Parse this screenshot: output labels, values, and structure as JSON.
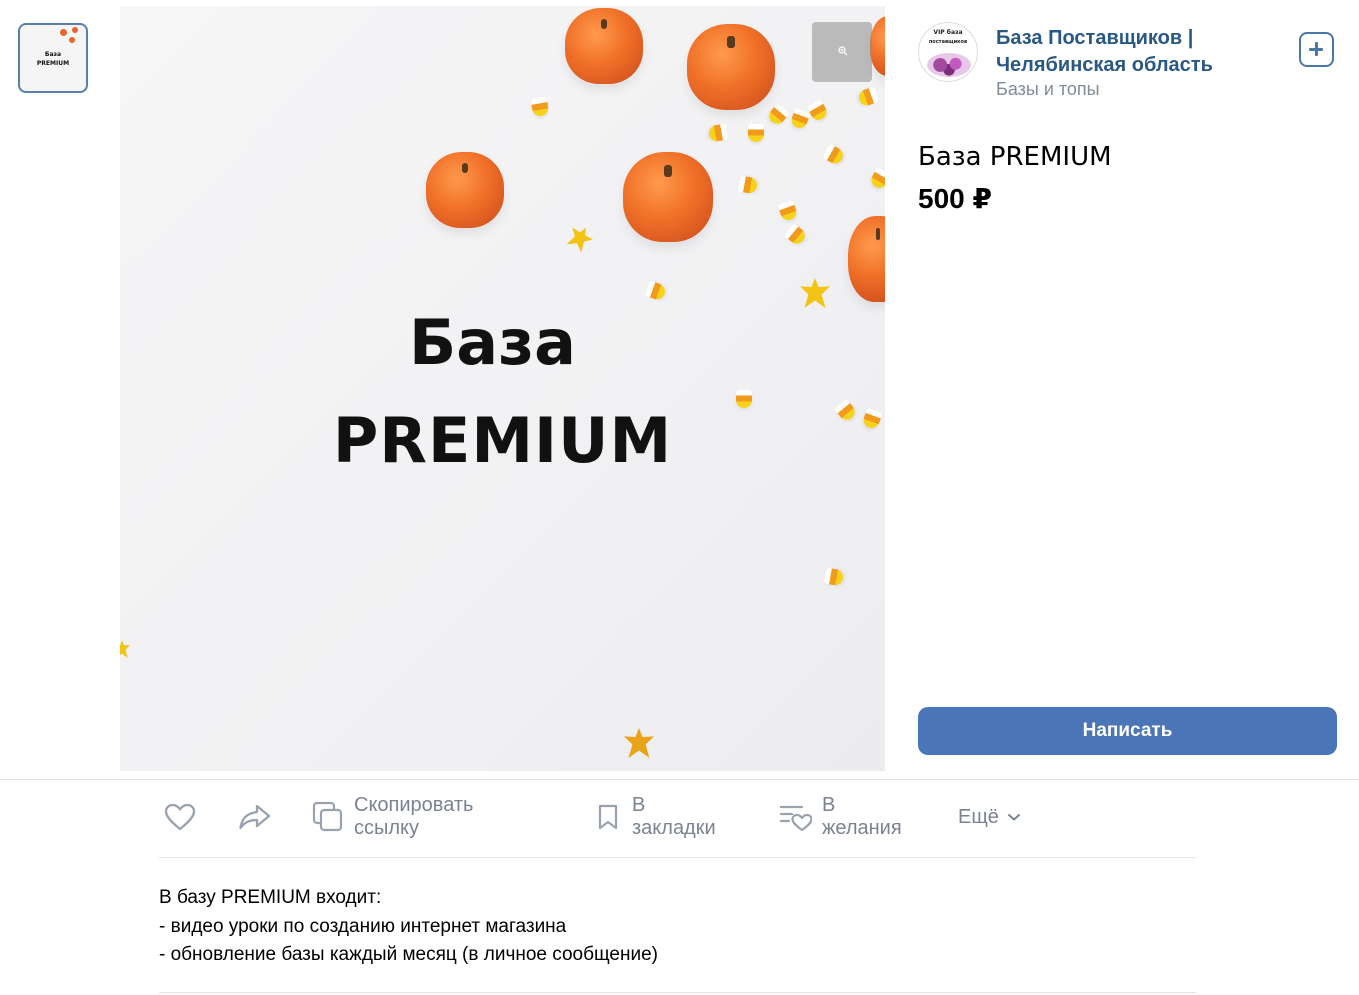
{
  "thumbnail": {
    "line1": "База",
    "line2": "PREMIUM"
  },
  "image": {
    "line1": "База",
    "line2": "PREMIUM"
  },
  "group": {
    "avatar_text_1": "VIP база",
    "avatar_text_2": "поставщиков",
    "name": "База Поставщиков | Челябинская область",
    "subtitle": "Базы и топы"
  },
  "product": {
    "title": "База PREMIUM",
    "price": "500 ₽"
  },
  "buttons": {
    "write": "Написать"
  },
  "actions": {
    "copy_link": "Скопировать ссылку",
    "bookmarks": "В закладки",
    "wishlist": "В желания",
    "more": "Ещё"
  },
  "description": {
    "lines": [
      "В базу PREMIUM входит:",
      "- видео уроки по созданию интернет магазина",
      "- обновление базы каждый месяц (в личное сообщение)"
    ]
  },
  "icons": {
    "like": "heart-icon",
    "share": "share-arrow-icon",
    "copy": "copy-icon",
    "bookmark": "bookmark-icon",
    "wishlist": "wishlist-heart-icon",
    "more": "chevron-down-icon",
    "zoom": "zoom-icon",
    "add": "add-square-icon"
  },
  "colors": {
    "accent": "#4a76b7",
    "link": "#2a5885",
    "muted": "#818c99"
  }
}
